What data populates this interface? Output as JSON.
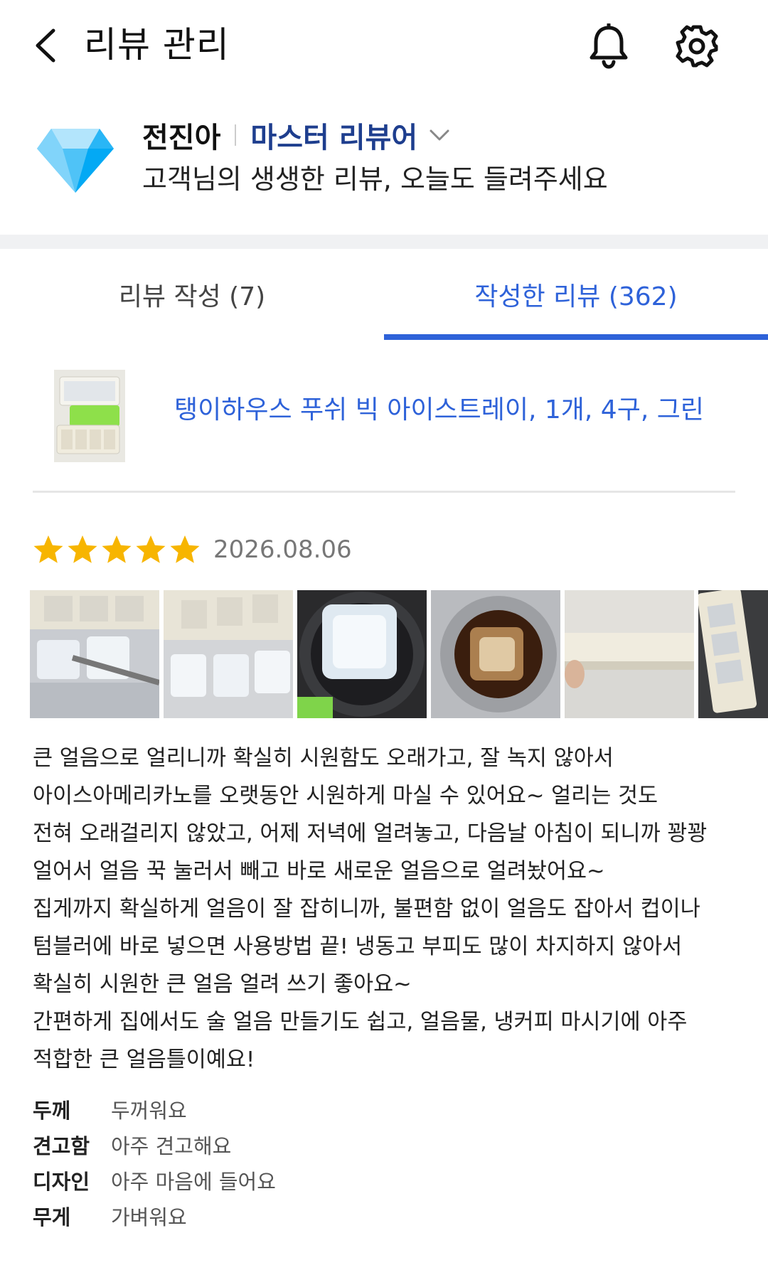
{
  "header": {
    "title": "리뷰 관리",
    "back_icon": "chevron-left-icon",
    "notification_icon": "bell-icon",
    "settings_icon": "gear-icon"
  },
  "profile": {
    "name": "전진아",
    "grade": "마스터 리뷰어",
    "subtitle": "고객님의 생생한 리뷰, 오늘도 들려주세요",
    "badge_icon": "diamond-icon",
    "grade_color": "#1e3e8e"
  },
  "tabs": [
    {
      "label": "리뷰 작성 (7)",
      "active": false
    },
    {
      "label": "작성한 리뷰 (362)",
      "active": true
    }
  ],
  "accent_color": "#2e62d9",
  "review": {
    "product_name": "탱이하우스 푸쉬 빅 아이스트레이, 1개, 4구, 그린",
    "rating": 5,
    "date": "2026.08.06",
    "photo_count_visible": 6,
    "text_lines": [
      "큰 얼음으로 얼리니까 확실히 시원함도 오래가고, 잘 녹지 않아서",
      "아이스아메리카노를 오랫동안 시원하게 마실 수 있어요~ 얼리는 것도",
      "전혀 오래걸리지 않았고, 어제 저녁에 얼려놓고, 다음날 아침이 되니까 꽝꽝",
      "얼어서 얼음 꾹 눌러서 빼고 바로 새로운 얼음으로 얼려놨어요~",
      "집게까지 확실하게 얼음이 잘 잡히니까, 불편함 없이 얼음도 잡아서 컵이나",
      "텀블러에 바로 넣으면 사용방법 끝! 냉동고 부피도 많이 차지하지 않아서",
      "확실히 시원한 큰 얼음 얼려 쓰기 좋아요~",
      "간편하게 집에서도 술 얼음 만들기도 쉽고, 얼음물, 냉커피 마시기에 아주",
      "적합한 큰 얼음틀이예요!"
    ],
    "attributes": [
      {
        "label": "두께",
        "value": "두꺼워요"
      },
      {
        "label": "견고함",
        "value": "아주 견고해요"
      },
      {
        "label": "디자인",
        "value": "아주 마음에 들어요"
      },
      {
        "label": "무게",
        "value": "가벼워요"
      }
    ]
  }
}
